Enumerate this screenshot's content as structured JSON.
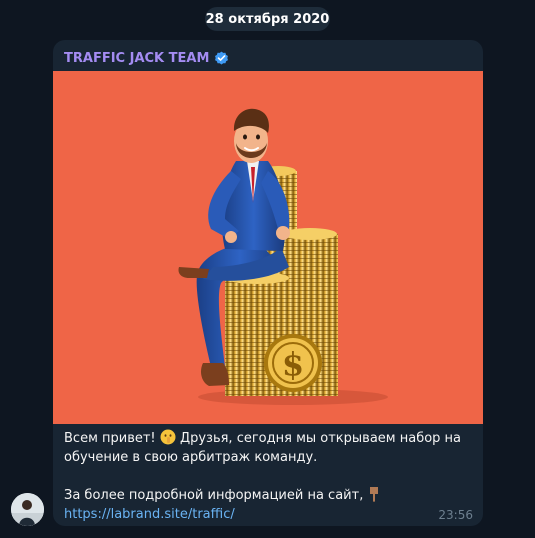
{
  "date_label": "28 октября 2020",
  "channel": {
    "name": "TRAFFIC JACK TEAM",
    "verified_icon": "verified-badge-icon"
  },
  "message": {
    "line1_prefix": "Всем привет!",
    "line1_emoji": "shushing-face-icon",
    "line1_suffix": "Друзья, сегодня мы открываем набор на обучение в свою арбитраж команду.",
    "line2_text": "За более подробной информацией на сайт,",
    "line2_emoji": "pointing-down-hand-icon",
    "link": "https://labrand.site/traffic/",
    "time": "23:56"
  },
  "media": {
    "background": "#ef6547",
    "image": "businessman-sitting-on-gold-coins-illustration"
  },
  "colors": {
    "background": "#0e1621",
    "bubble": "#182533",
    "accent": "#a48cf2",
    "link": "#6ab3f3"
  }
}
